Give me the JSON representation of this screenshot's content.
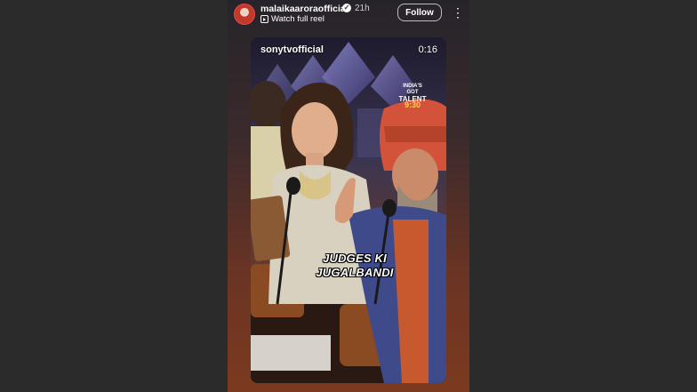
{
  "story": {
    "username": "malaikaaroraofficial",
    "timestamp": "21h",
    "watch_link": "Watch full reel",
    "follow_label": "Follow",
    "more_label": "⋮"
  },
  "reel": {
    "source_account": "sonytvofficial",
    "playback_time": "0:16",
    "caption_line1": "JUDGES KI",
    "caption_line2": "JUGALBANDI",
    "show_logo_line1": "INDIA'S GOT",
    "show_logo_line2": "TALENT",
    "show_logo_line3": "9:30"
  }
}
